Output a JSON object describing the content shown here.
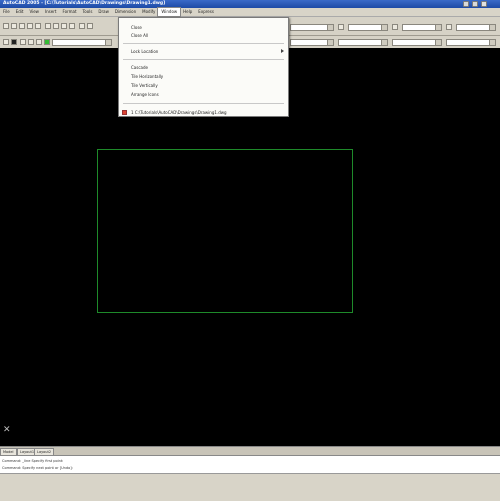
{
  "window": {
    "title": "AutoCAD 2005 - [C:\\Tutorials\\AutoCAD\\Drawings\\Drawing1.dwg]"
  },
  "menubar": {
    "items": [
      "File",
      "Edit",
      "View",
      "Insert",
      "Format",
      "Tools",
      "Draw",
      "Dimension",
      "Modify",
      "Window",
      "Help",
      "Express"
    ],
    "active_index": 9
  },
  "window_menu": {
    "items": [
      {
        "label": "Close"
      },
      {
        "label": "Close All"
      },
      {
        "label": "Lock Location",
        "submenu": true
      },
      {
        "label": "Cascade"
      },
      {
        "label": "Tile Horizontally"
      },
      {
        "label": "Tile Vertically"
      },
      {
        "label": "Arrange Icons"
      },
      {
        "label": "1 C:\\Tutorials\\AutoCAD\\Drawings\\Drawing1.dwg",
        "checked": true
      }
    ]
  },
  "layout_tabs": [
    "Model",
    "Layout1",
    "Layout2"
  ],
  "command_line": {
    "line1": "Command: _line  Specify first point:",
    "line2": "Command:  Specify next point or [Undo]:"
  },
  "colors": {
    "drawing_background": "#000000",
    "rectangle_stroke": "#1e8a2a",
    "title_bar": "#1d4aa6"
  }
}
